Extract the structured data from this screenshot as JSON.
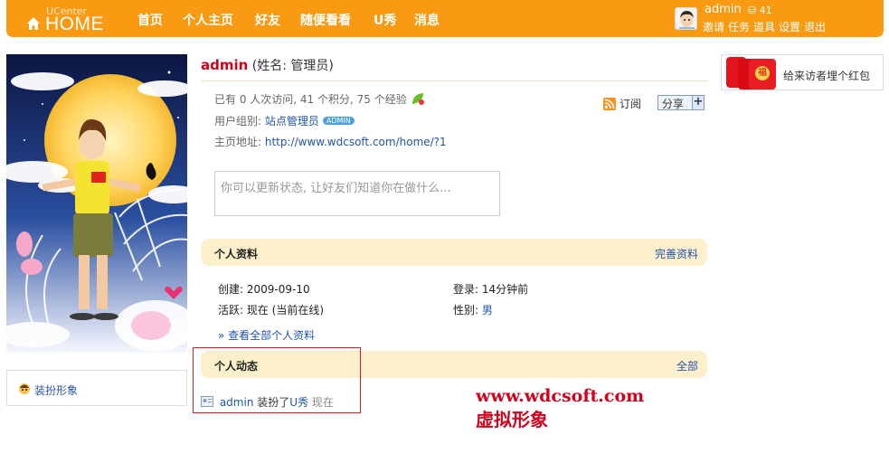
{
  "header": {
    "logo_small": "UCenter",
    "logo_big": "HOME",
    "nav": [
      "首页",
      "个人主页",
      "好友",
      "随便看看",
      "U秀",
      "消息"
    ],
    "username": "admin",
    "coins": "41",
    "links": [
      "邀请",
      "任务",
      "道具",
      "设置",
      "退出"
    ]
  },
  "sidebar": {
    "dress_link": "装扮形象"
  },
  "profile": {
    "name": "admin",
    "realname": "(姓名: 管理员)",
    "stats": "已有 0 人次访问, 41 个积分, 75 个经验",
    "group_label": "用户组别:",
    "group_value": "站点管理员",
    "group_badge": "ADMIN",
    "homepage_label": "主页地址:",
    "homepage_url": "http://www.wdcsoft.com/home/?1",
    "subscribe": "订阅",
    "share": "分享",
    "share_plus": "+",
    "status_placeholder": "你可以更新状态, 让好友们知道你在做什么..."
  },
  "personal_info": {
    "title": "个人资料",
    "edit_link": "完善资料",
    "created": "创建: 2009-09-10",
    "login": "登录: 14分钟前",
    "active": "活跃: 现在 (当前在线)",
    "gender_label": "性别:",
    "gender_value": "男",
    "view_all": "» 查看全部个人资料"
  },
  "activity": {
    "title": "个人动态",
    "all_link": "全部",
    "item_user": "admin",
    "item_action": "装扮了",
    "item_target": "U秀",
    "item_time": "现在"
  },
  "promo": {
    "text": "给来访者埋个红包"
  },
  "watermark": {
    "line1": "www.wdcsoft.com",
    "line2": "虚拟形象"
  },
  "colors": {
    "topbar": "#f99a13",
    "section_bg": "#fcf0cc",
    "link": "#2255aa",
    "name_red": "#d0021b"
  }
}
